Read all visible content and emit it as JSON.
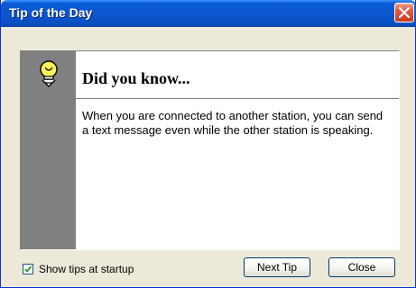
{
  "window": {
    "title": "Tip of the Day"
  },
  "tip": {
    "heading": "Did you know...",
    "text": "When you are connected to another station, you can send a text message even while the other station is speaking."
  },
  "options": {
    "show_tips_label": "Show tips at startup",
    "show_tips_checked": true
  },
  "buttons": {
    "next_label": "Next Tip",
    "close_label": "Close"
  },
  "icons": {
    "title_close": "close-icon",
    "tip": "lightbulb-icon",
    "checkbox": "checkmark-icon"
  },
  "colors": {
    "titlebar": "#0a5bd6",
    "close_button": "#e2583e",
    "side_band": "#808080",
    "dialog_bg": "#ece9d8"
  }
}
